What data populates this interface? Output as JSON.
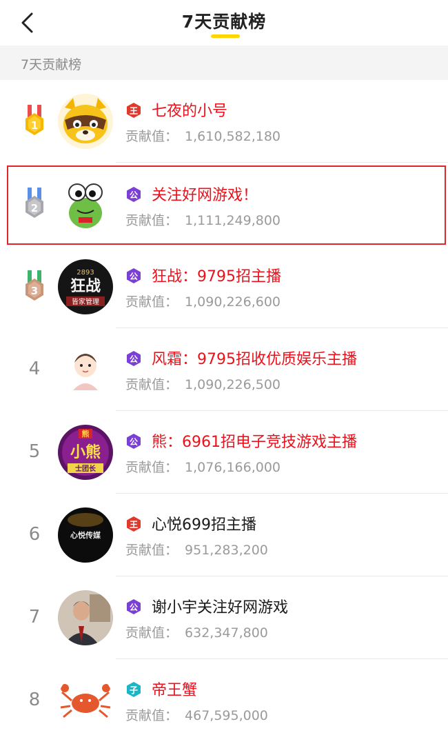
{
  "header": {
    "title": "7天贡献榜"
  },
  "section": {
    "label": "7天贡献榜"
  },
  "contrib_label": "贡献值：",
  "rows": [
    {
      "rank": "1",
      "name": "七夜的小号",
      "value": "1,610,582,180",
      "badge": "王",
      "badge_type": "king",
      "name_color": "red"
    },
    {
      "rank": "2",
      "name": "关注好网游戏！",
      "value": "1,111,249,800",
      "badge": "公",
      "badge_type": "duke",
      "name_color": "red"
    },
    {
      "rank": "3",
      "name": "狂战：9795招主播",
      "value": "1,090,226,600",
      "badge": "公",
      "badge_type": "duke",
      "name_color": "red"
    },
    {
      "rank": "4",
      "name": "风霜：9795招收优质娱乐主播",
      "value": "1,090,226,500",
      "badge": "公",
      "badge_type": "duke",
      "name_color": "red"
    },
    {
      "rank": "5",
      "name": "熊：6961招电子竞技游戏主播",
      "value": "1,076,166,000",
      "badge": "公",
      "badge_type": "duke",
      "name_color": "red"
    },
    {
      "rank": "6",
      "name": "心悦699招主播",
      "value": "951,283,200",
      "badge": "王",
      "badge_type": "king",
      "name_color": "black"
    },
    {
      "rank": "7",
      "name": "谢小宇关注好网游戏",
      "value": "632,347,800",
      "badge": "公",
      "badge_type": "duke",
      "name_color": "black"
    },
    {
      "rank": "8",
      "name": "帝王蟹",
      "value": "467,595,000",
      "badge": "子",
      "badge_type": "viscount",
      "name_color": "red"
    }
  ],
  "avatars": {
    "r3_line1": "2893",
    "r3_line2": "狂战",
    "r3_line3": "皆家管理",
    "r5_top": "熊",
    "r5_mid": "小熊",
    "r5_bottom": "士团长",
    "r6_text": "心悦传媒"
  },
  "colors": {
    "accent": "#ffd600",
    "name_red": "#e9121c",
    "selection": "#e0242c",
    "badge_king": "#e03a2e",
    "badge_duke": "#7b3fd3",
    "badge_viscount": "#1db5c4",
    "medal_gold": "#f5b800",
    "medal_silver": "#a7a7ad",
    "medal_bronze": "#c9967a"
  }
}
